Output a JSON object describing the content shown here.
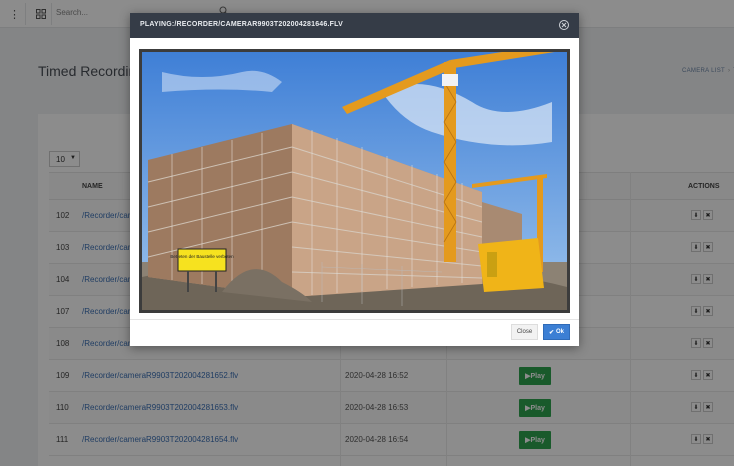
{
  "topbar": {
    "menu_icon": "vertical-dots-icon",
    "grid_icon": "grid-icon",
    "search_placeholder": "Search..."
  },
  "page": {
    "title": "Timed Recordin",
    "breadcrumbs": [
      "CAMERA LIST",
      "T"
    ]
  },
  "table": {
    "per_page": "10",
    "headers": {
      "name": "NAME",
      "actions": "ACTIONS"
    },
    "play_label": "Play",
    "rows": [
      {
        "id": "102",
        "name": "/Recorder/camera",
        "date": ""
      },
      {
        "id": "103",
        "name": "/Recorder/camera",
        "date": ""
      },
      {
        "id": "104",
        "name": "/Recorder/camera",
        "date": ""
      },
      {
        "id": "107",
        "name": "/Recorder/camera",
        "date": ""
      },
      {
        "id": "108",
        "name": "/Recorder/camera",
        "date": ""
      },
      {
        "id": "109",
        "name": "/Recorder/cameraR9903T202004281652.flv",
        "date": "2020-04-28 16:52"
      },
      {
        "id": "110",
        "name": "/Recorder/cameraR9903T202004281653.flv",
        "date": "2020-04-28 16:53"
      },
      {
        "id": "111",
        "name": "/Recorder/cameraR9903T202004281654.flv",
        "date": "2020-04-28 16:54"
      }
    ]
  },
  "modal": {
    "title": "PLAYING:/RECORDER/CAMERAR9903T202004281646.FLV",
    "close_label": "Close",
    "ok_label": "Ok",
    "sign_text": "Betreten der Baustelle verboten"
  },
  "colors": {
    "header_bg": "#353c47",
    "play_green": "#2ea44f",
    "ok_blue": "#3c7fd4",
    "link_blue": "#3b70b5"
  }
}
